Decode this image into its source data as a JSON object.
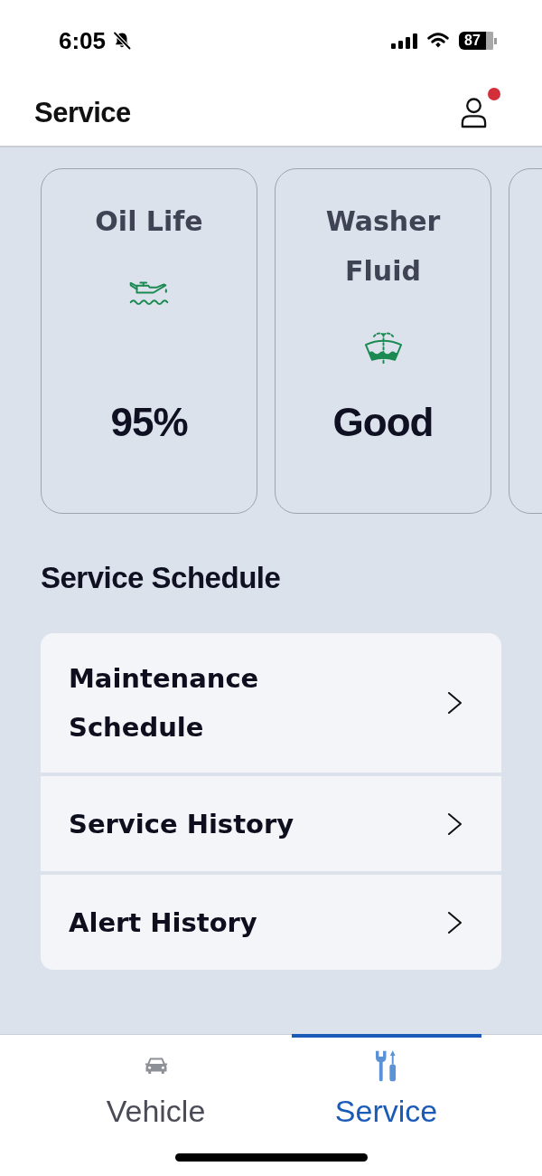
{
  "status_bar": {
    "time": "6:05",
    "silent": true,
    "battery": "87"
  },
  "header": {
    "title": "Service",
    "notification_dot": true
  },
  "cards": [
    {
      "kind": "oil",
      "title": "Oil Life",
      "value": "95%"
    },
    {
      "kind": "washer",
      "title": "Washer Fluid",
      "value": "Good"
    }
  ],
  "service_schedule": {
    "title": "Service Schedule",
    "items": [
      {
        "label": "Maintenance Schedule"
      },
      {
        "label": "Service History"
      },
      {
        "label": "Alert History"
      }
    ]
  },
  "tab_bar": {
    "tabs": [
      {
        "kind": "vehicle",
        "label": "Vehicle",
        "selected": false
      },
      {
        "kind": "service",
        "label": "Service",
        "selected": true
      }
    ]
  }
}
